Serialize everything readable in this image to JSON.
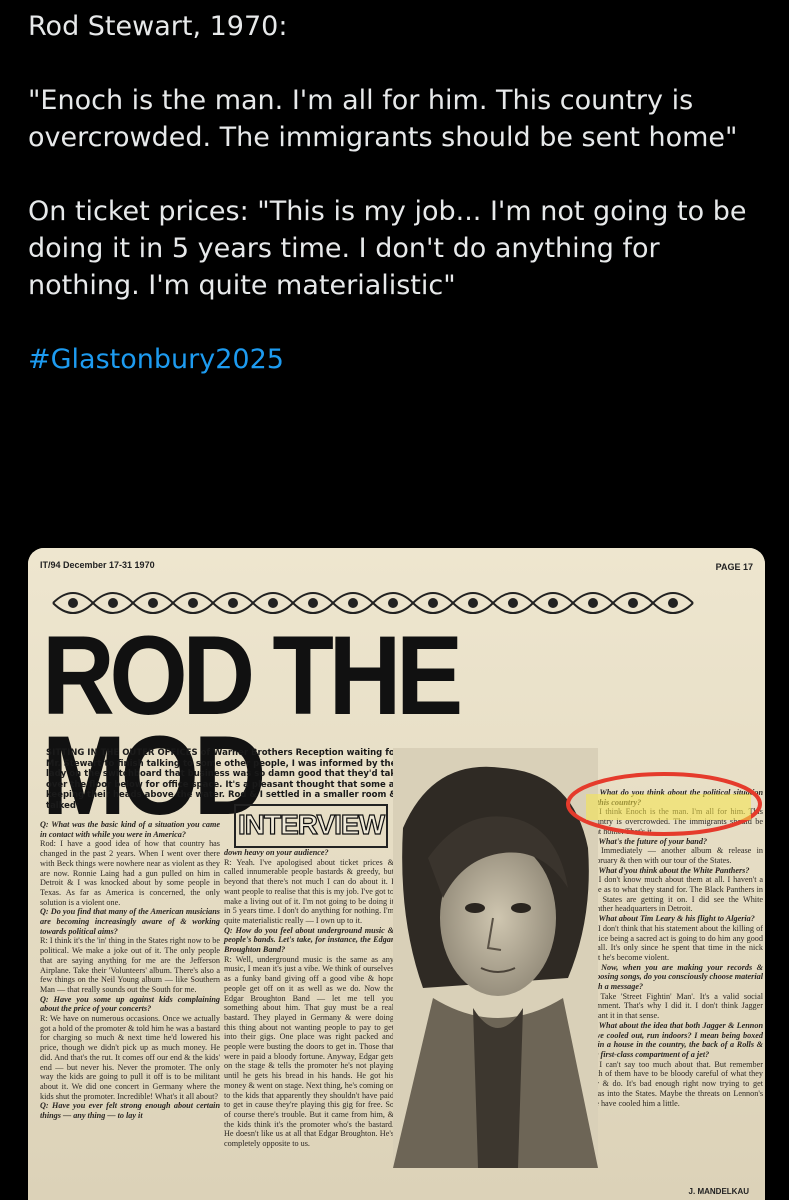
{
  "post": {
    "paragraphs": [
      "Rod Stewart, 1970:",
      "\"Enoch is the man. I'm all for him. This country is overcrowded. The immigrants should be sent home\"",
      "On ticket prices: \"This is my job... I'm not going to be doing it in 5 years time. I don't do anything for nothing. I'm quite materialistic\""
    ],
    "hashtag": "#Glastonbury2025",
    "hashtag_color": "#1d9bf0"
  },
  "clipping": {
    "header_left": "IT/94  December 17-31 1970",
    "header_right": "PAGE 17",
    "headline": "ROD THE MOD",
    "banner": "INTERVIEW",
    "intro": "SITTING IN THE OUTER OFFICES of Warner Brothers Reception waiting for Mr. Stewart to finish talking to some other people, I was informed by the lady on the switchboard that business was so damn good that they'd taken over the floor below for office space. It's a pleasant thought that some are keeping their heads above the water. Rod & I settled in a smaller room & talked:",
    "col1": [
      {
        "q": "Q: What was the basic kind of a situation you came in contact with while you were in America?"
      },
      {
        "a": "Rod: I have a good idea of how that country has changed in the past 2 years. When I went over there with Beck things were nowhere near as violent as they are now. Ronnie Laing had a gun pulled on him in Detroit & I was knocked about by some people in Texas. As far as America is concerned, the only solution is a violent one."
      },
      {
        "q": "Q: Do you find that many of the American musicians are becoming increasingly aware of & working towards political aims?"
      },
      {
        "a": "R: I think it's the 'in' thing in the States right now to be political. We make a joke out of it. The only people that are saying anything for me are the Jefferson Airplane. Take their 'Volunteers' album. There's also a few things on the Neil Young album — like Southern Man — that really sounds out the South for me."
      },
      {
        "q": "Q: Have you some up against kids complaining about the price of your concerts?"
      },
      {
        "a": "R: We have on numerous occasions. Once we actually got a hold of the promoter & told him he was a bastard for charging so much & next time he'd lowered his price, though we didn't pick up as much money. He did. And that's the rut. It comes off our end & the kids' end — but never his. Never the promoter. The only way the kids are going to pull it off is to be militant about it. We did one concert in Germany where the kids shut the promoter. Incredible! What's it all about?"
      },
      {
        "q": "Q: Have you ever felt strong enough about certain things — any thing — to lay it"
      }
    ],
    "col2": [
      {
        "q": "down heavy on your audience?"
      },
      {
        "a": "R: Yeah. I've apologised about ticket prices & called innumerable people bastards & greedy, but beyond that there's not much I can do about it. I want people to realise that this is my job. I've got to make a living out of it. I'm not going to be doing it in 5 years time. I don't do anything for nothing. I'm quite materialistic really — I own up to it."
      },
      {
        "q": "Q: How do you feel about underground music & people's bands. Let's take, for instance, the Edgar Broughton Band?"
      },
      {
        "a": "R: Well, underground music is the same as any music, I mean it's just a vibe. We think of ourselves as a funky band giving off a good vibe & hope people get off on it as well as we do. Now the Edgar Broughton Band — let me tell you something about him. That guy must be a real bastard. They played in Germany & were doing this thing about not wanting people to pay to get into their gigs. One place was right packed and people were busting the doors to get in. Those that were in paid a bloody fortune. Anyway, Edgar gets on the stage & tells the promoter he's not playing until he gets his bread in his hands. He got his money & went on stage. Next thing, he's coming on to the kids that apparently they shouldn't have paid to get in cause they're playing this gig for free. So of course there's trouble. But it came from him, & the kids think it's the promoter who's the bastard. He doesn't like us at all that Edgar Broughton. He's completely opposite to us."
      }
    ],
    "col3": [
      {
        "q": "Q: What do you think about the political situation in this country?"
      },
      {
        "a": "R: I think Enoch is the man. I'm all for him. This country is overcrowded. The immigrants should be sent home. That's it."
      },
      {
        "q": "Q: What's the future of your band?"
      },
      {
        "a": "R: Immediately — another album & release in February & then with our tour of the States."
      },
      {
        "q": "Q: What d'you think about the White Panthers?"
      },
      {
        "a": "R: I don't know much about them at all. I haven't a clue as to what they stand for. The Black Panthers in the States are getting it on. I did see the White Panther headquarters in Detroit."
      },
      {
        "q": "Q: What about Tim Leary & his flight to Algeria?"
      },
      {
        "a": "R: I don't think that his statement about the killing of police being a sacred act is going to do him any good at all. It's only since he spent that time in the nick that he's become violent."
      },
      {
        "q": "Q: Now, when you are making your records & choosing songs, do you consciously choose material with a message?"
      },
      {
        "a": "R: Take 'Street Fightin' Man'. It's a valid social comment. That's why I did it. I don't think Jagger meant it in that sense."
      },
      {
        "q": "Q: What about the idea that both Jagger & Lennon have cooled out, run indoors? I mean being boxed in in a house in the country, the back of a Rolls & the first-class compartment of a jet?"
      },
      {
        "a": "R: I can't say too much about that. But remember both of them have to be bloody careful of what they say & do. It's bad enough right now trying to get visas into the States. Maybe the threats on Lennon's life have cooled him a little."
      }
    ],
    "byline": "J. MANDELKAU",
    "highlight_color": "#e53b2c"
  }
}
